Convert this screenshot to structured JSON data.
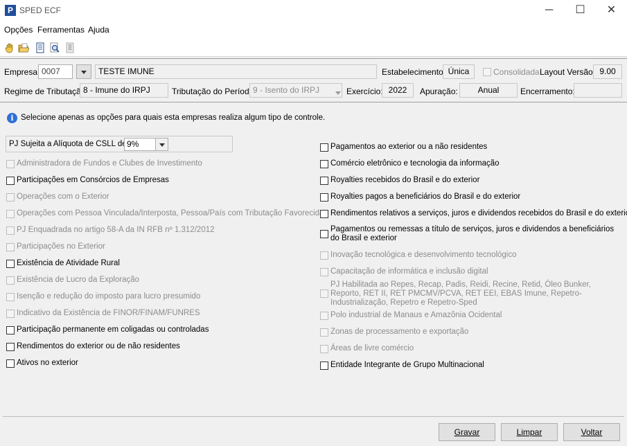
{
  "window": {
    "app_logo": "P",
    "title": "SPED ECF",
    "minimize_glyph": "─",
    "maximize_glyph": "☐",
    "close_glyph": "✕"
  },
  "menu": {
    "items": [
      "Opções",
      "Ferramentas",
      "Ajuda"
    ]
  },
  "toolbar": {
    "icons": [
      "hand-icon",
      "open-folder-icon",
      "document-icon",
      "search-document-icon",
      "grid-document-icon"
    ]
  },
  "header": {
    "empresa_label": "Empresa:",
    "empresa_code": "0007",
    "empresa_name": "TESTE IMUNE",
    "estabelecimento_label": "Estabelecimento:",
    "estabelecimento_value": "Única",
    "consolidada_label": "Consolidada",
    "layout_label": "Layout Versão:",
    "layout_value": "9.00",
    "regime_label": "Regime de Tributação:",
    "regime_value": "8 - Imune do IRPJ",
    "tributacao_label": "Tributação do Período:",
    "tributacao_value": "9 - Isento do IRPJ",
    "exercicio_label": "Exercício:",
    "exercicio_value": "2022",
    "apuracao_label": "Apuração:",
    "apuracao_value": "Anual",
    "encerramento_label": "Encerramento:",
    "encerramento_value": ""
  },
  "content": {
    "info_text": "Selecione apenas as opções para quais esta  empresas realiza algum tipo de controle.",
    "csll_label": "PJ Sujeita a Alíquota de CSLL de:",
    "csll_value": "9%",
    "left_options": [
      {
        "label": "Administradora de Fundos e Clubes de Investimento",
        "enabled": false
      },
      {
        "label": "Participações em Consórcios de Empresas",
        "enabled": true
      },
      {
        "label": "Operações com o Exterior",
        "enabled": false
      },
      {
        "label": "Operações com Pessoa Vinculada/Interposta, Pessoa/País com Tributação Favorecida",
        "enabled": false
      },
      {
        "label": "PJ Enquadrada no artigo 58-A da IN RFB nº 1.312/2012",
        "enabled": false
      },
      {
        "label": "Participações no Exterior",
        "enabled": false
      },
      {
        "label": "Existência de Atividade Rural",
        "enabled": true
      },
      {
        "label": "Existência de Lucro da Exploração",
        "enabled": false
      },
      {
        "label": "Isenção e redução do imposto para lucro presumido",
        "enabled": false
      },
      {
        "label": "Indicativo da Existência de FINOR/FINAM/FUNRES",
        "enabled": false
      },
      {
        "label": "Participação permanente em coligadas ou controladas",
        "enabled": true
      },
      {
        "label": "Rendimentos do exterior ou de não residentes",
        "enabled": true
      },
      {
        "label": "Ativos no exterior",
        "enabled": true
      }
    ],
    "right_options": [
      {
        "label": "Pagamentos ao exterior ou a não residentes",
        "enabled": true
      },
      {
        "label": "Comércio eletrônico e tecnologia da informação",
        "enabled": true
      },
      {
        "label": "Royalties recebidos do Brasil e do exterior",
        "enabled": true
      },
      {
        "label": "Royalties pagos a beneficiários do Brasil e do exterior",
        "enabled": true
      },
      {
        "label": "Rendimentos relativos a serviços, juros e dividendos recebidos do Brasil e do exterior",
        "enabled": true
      },
      {
        "label": "Pagamentos ou remessas a título de serviços, juros e dividendos a beneficiários do Brasil e exterior",
        "enabled": true
      },
      {
        "label": "Inovação tecnológica e desenvolvimento tecnológico",
        "enabled": false
      },
      {
        "label": "Capacitação de informática e inclusão digital",
        "enabled": false
      },
      {
        "label": "PJ Habilitada ao Repes, Recap, Padis, Reidi, Recine, Retid, Óleo Bunker, Reporto, RET II, RET PMCMV/PCVA, RET EEI, EBAS Imune, Repetro-Industrialização, Repetro e Repetro-Sped",
        "enabled": false
      },
      {
        "label": "Polo industrial de Manaus e Amazônia Ocidental",
        "enabled": false
      },
      {
        "label": "Zonas de processamento e exportação",
        "enabled": false
      },
      {
        "label": "Áreas de livre comércio",
        "enabled": false
      },
      {
        "label": "Entidade Integrante de Grupo Multinacional",
        "enabled": true
      }
    ]
  },
  "footer": {
    "gravar": "Gravar",
    "limpar": "Limpar",
    "voltar": "Voltar"
  }
}
